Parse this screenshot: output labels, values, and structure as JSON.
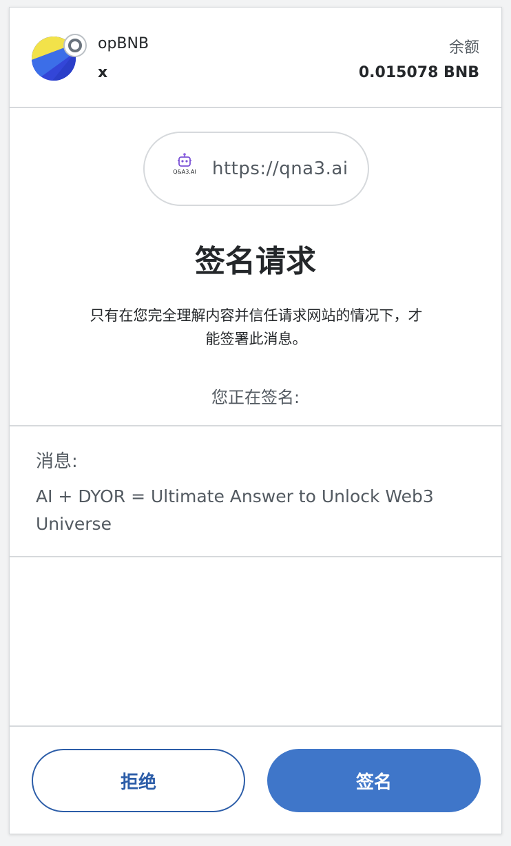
{
  "header": {
    "network_name": "opBNB",
    "account_name": "x",
    "balance_label": "余额",
    "balance_value": "0.015078 BNB",
    "avatar_icon": "account-jazzicon",
    "network_icon": "network-status-icon"
  },
  "origin": {
    "url": "https://qna3.ai",
    "site_icon_label": "Q&A3.AI",
    "site_icon": "robot-logo-icon"
  },
  "request": {
    "title": "签名请求",
    "warning": "只有在您完全理解内容并信任请求网站的情况下，才能签署此消息。",
    "signing_label": "您正在签名:"
  },
  "message": {
    "label": "消息:",
    "text": "AI + DYOR = Ultimate Answer to Unlock Web3 Universe"
  },
  "footer": {
    "reject_label": "拒绝",
    "sign_label": "签名"
  },
  "colors": {
    "primary": "#3f76c9",
    "primary_outline": "#2c5da8",
    "divider": "#d6d9dc",
    "text_muted": "#535a61"
  }
}
